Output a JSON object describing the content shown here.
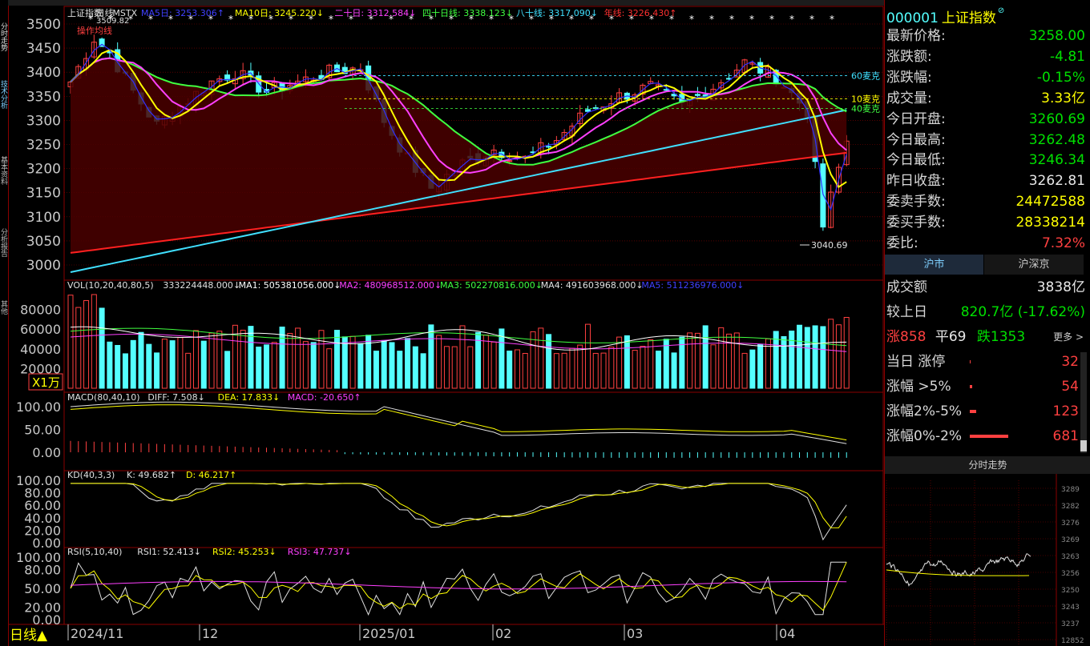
{
  "period_label": "日线▲",
  "stock": {
    "code": "000001",
    "name": "上证指数",
    "icon": "info-circle-icon"
  },
  "main_legend": [
    {
      "text": "上证指数",
      "color": "#e0e0e0"
    },
    {
      "text": "日线",
      "color": "#e0e0e0"
    },
    {
      "text": "MSTX",
      "color": "#e0e0e0"
    },
    {
      "text": "MA5日: 3253.306↑",
      "color": "#4040ff"
    },
    {
      "text": "MA10日: 3245.220↓",
      "color": "#ffff00"
    },
    {
      "text": "二十日: 3312.584↓",
      "color": "#ff40ff"
    },
    {
      "text": "四十日线: 3338.123↓",
      "color": "#40ff40"
    },
    {
      "text": "八十线: 3317.090↓",
      "color": "#40e0ff"
    },
    {
      "text": "年线: 3226.430↑",
      "color": "#ff3030"
    }
  ],
  "sub_label_main": "操作均线",
  "high_marker": "3509.82",
  "low_marker": "3040.69",
  "ma_right_labels": [
    {
      "text": "60麦克",
      "color": "#40e0ff"
    },
    {
      "text": "10麦克",
      "color": "#ffff00"
    },
    {
      "text": "40麦克",
      "color": "#40ff40"
    }
  ],
  "price_axis": [
    "3500",
    "3450",
    "3400",
    "3350",
    "3300",
    "3250",
    "3200",
    "3150",
    "3100",
    "3050",
    "3000"
  ],
  "vol_legend": [
    {
      "text": "VOL(10,20,40,80,5)",
      "color": "#e0e0e0"
    },
    {
      "text": "333224448.000↓",
      "color": "#e0e0e0"
    },
    {
      "text": "MA1: 505381056.000↓",
      "color": "#ffffff"
    },
    {
      "text": "MA2: 480968512.000↓",
      "color": "#ff40ff"
    },
    {
      "text": "MA3: 502270816.000↓",
      "color": "#40ff40"
    },
    {
      "text": "MA4: 491603968.000↓",
      "color": "#e0e0e0"
    },
    {
      "text": "MA5: 511236976.000↓",
      "color": "#4040ff"
    }
  ],
  "vol_axis": [
    "80000",
    "60000",
    "40000",
    "20000"
  ],
  "vol_unit": "X1万",
  "macd_legend": [
    {
      "text": "MACD(80,40,10)",
      "color": "#e0e0e0"
    },
    {
      "text": "DIFF: 7.508↓",
      "color": "#e0e0e0"
    },
    {
      "text": "DEA: 17.833↓",
      "color": "#ffff00"
    },
    {
      "text": "MACD: -20.650↑",
      "color": "#ff40ff"
    }
  ],
  "macd_axis": [
    "100.00",
    "50.00",
    "0.00"
  ],
  "kd_legend": [
    {
      "text": "KD(40,3,3)",
      "color": "#e0e0e0"
    },
    {
      "text": "K: 49.682↑",
      "color": "#e0e0e0"
    },
    {
      "text": "D: 46.217↑",
      "color": "#ffff00"
    }
  ],
  "kd_axis": [
    "100.00",
    "80.00",
    "60.00",
    "40.00",
    "20.00",
    "0.00"
  ],
  "rsi_legend": [
    {
      "text": "RSI(5,10,40)",
      "color": "#e0e0e0"
    },
    {
      "text": "RSI1: 52.413↓",
      "color": "#e0e0e0"
    },
    {
      "text": "RSI2: 45.253↓",
      "color": "#ffff00"
    },
    {
      "text": "RSI3: 47.737↓",
      "color": "#ff40ff"
    }
  ],
  "rsi_axis": [
    "100.00",
    "80.00",
    "50.00",
    "20.00",
    "0.00"
  ],
  "date_axis": [
    "2024/11",
    "12",
    "2025/01",
    "02",
    "03",
    "04"
  ],
  "quote": [
    {
      "label": "最新价格:",
      "value": "3258.00",
      "cls": "green"
    },
    {
      "label": "涨跌额:",
      "value": "-4.81",
      "cls": "green"
    },
    {
      "label": "涨跌幅:",
      "value": "-0.15%",
      "cls": "green"
    },
    {
      "label": "成交量:",
      "value": "3.33亿",
      "cls": "yellow"
    },
    {
      "label": "今日开盘:",
      "value": "3260.69",
      "cls": "green"
    },
    {
      "label": "今日最高:",
      "value": "3262.48",
      "cls": "green"
    },
    {
      "label": "今日最低:",
      "value": "3246.34",
      "cls": "green"
    },
    {
      "label": "昨日收盘:",
      "value": "3262.81",
      "cls": "white"
    },
    {
      "label": "委卖手数:",
      "value": "24472588",
      "cls": "yellow"
    },
    {
      "label": "委买手数:",
      "value": "28338214",
      "cls": "yellow"
    },
    {
      "label": "委比:",
      "value": "7.32%",
      "cls": "red"
    }
  ],
  "market_tabs": [
    "沪市",
    "沪深京"
  ],
  "turnover": {
    "label": "成交额",
    "value": "3838亿"
  },
  "vs_prev": {
    "label": "较上日",
    "value": "820.7亿 (-17.62%)"
  },
  "breadth": {
    "up": "涨858",
    "flat": "平69",
    "down": "跌1353",
    "more": "更多 >"
  },
  "dist": [
    {
      "label": "当日 涨停",
      "value": "32",
      "bar": 1
    },
    {
      "label": "涨幅 >5%",
      "value": "54",
      "bar": 3
    },
    {
      "label": "涨幅2%-5%",
      "value": "123",
      "bar": 8
    },
    {
      "label": "涨幅0%-2%",
      "value": "681",
      "bar": 48
    }
  ],
  "intraday_title": "分时走势",
  "intraday_axis": [
    "3289",
    "3282",
    "3276",
    "3269",
    "3263",
    "3256",
    "3250",
    "3243",
    "3237",
    "12852"
  ],
  "colors": {
    "up": "#ff4040",
    "down": "#54ffff",
    "grid": "#8a0000"
  }
}
